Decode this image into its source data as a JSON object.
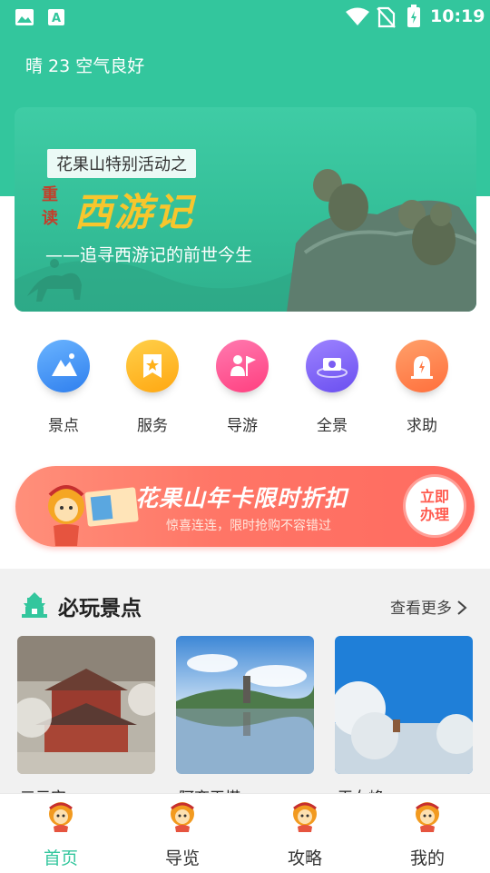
{
  "status_bar": {
    "time": "10:19",
    "icons": [
      "image-icon",
      "a-icon",
      "wifi-icon",
      "no-sim-icon",
      "battery-icon"
    ]
  },
  "header": {
    "weather": "晴 23 空气良好",
    "bg_color": "#33c69d"
  },
  "banner": {
    "subtitle": "花果山特别活动之",
    "reread": "重读",
    "title": "西游记",
    "tagline": "——追寻西游记的前世今生"
  },
  "menu": [
    {
      "label": "景点",
      "icon": "mountain-icon",
      "color": "#3a8bf0"
    },
    {
      "label": "服务",
      "icon": "bookmark-icon",
      "color": "#ffb11a"
    },
    {
      "label": "导游",
      "icon": "guide-flag-icon",
      "color": "#ff4f8c"
    },
    {
      "label": "全景",
      "icon": "camera-icon",
      "color": "#7a5cf2"
    },
    {
      "label": "求助",
      "icon": "alert-icon",
      "color": "#ff7a45"
    }
  ],
  "promo": {
    "title": "花果山年卡限时折扣",
    "subtitle": "惊喜连连，限时抢购不容错过",
    "button": "立即\n办理"
  },
  "section": {
    "title": "必玩景点",
    "more": "查看更多",
    "spots": [
      {
        "name": "三元宫"
      },
      {
        "name": "阿育王塔"
      },
      {
        "name": "玉女峰"
      }
    ]
  },
  "bottom_nav": [
    {
      "label": "首页",
      "active": true
    },
    {
      "label": "导览",
      "active": false
    },
    {
      "label": "攻略",
      "active": false
    },
    {
      "label": "我的",
      "active": false
    }
  ],
  "colors": {
    "accent": "#33c69d",
    "active_tab": "#33c69d"
  }
}
